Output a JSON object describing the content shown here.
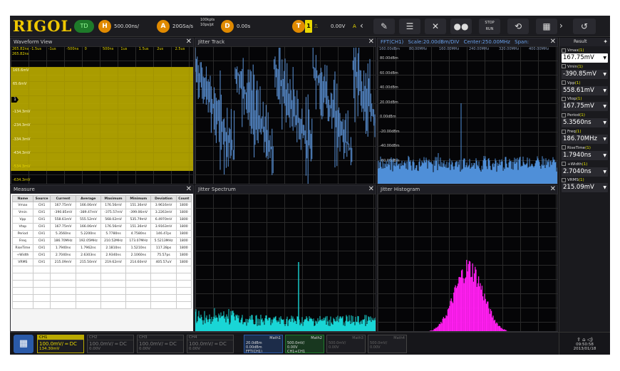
{
  "brand": "RIGOL",
  "topbar": {
    "mode": "TD",
    "h_badge": "H",
    "timebase": "500.00ns/",
    "a_badge": "A",
    "sample_rate": "20GSa/s",
    "memory_line1": "100kpts",
    "memory_line2": "10ps/pt",
    "d_badge": "D",
    "delay": "0.00s",
    "t_badge": "T",
    "trig_ch": "1",
    "trig_level": "0.00V",
    "a_badge2": "A",
    "run_stop_line1": "STOP",
    "run_stop_line2": "RUN",
    "icons": [
      "pen-icon",
      "menu-icon",
      "measure-icon",
      "dots-icon",
      "run-stop-icon",
      "history-icon",
      "apps-icon",
      "back-icon"
    ]
  },
  "waveform": {
    "title": "Waveform View",
    "time_row": [
      "265.82ns",
      "-1.5us",
      "-1us",
      "-500ns",
      "0",
      "500ns",
      "1us",
      "1.5us",
      "2us",
      "2.5us"
    ],
    "top_label": "265.82ns",
    "y_labels": [
      "165.6mV",
      "65.6mV",
      "",
      "-134.3mV",
      "-234.3mV",
      "-334.3mV",
      "-434.3mV",
      "-534.3mV",
      "-634.3mV"
    ],
    "ch_marker": "1"
  },
  "jitter_track": {
    "title": "Jitter Track"
  },
  "fft": {
    "title": "FFT(CH1)",
    "scale": "Scale:20.00dBm/DIV",
    "center": "Center:250.00MHz",
    "span": "Span:",
    "freq_row": [
      "160.00dBm",
      "80.00MHz",
      "160.00MHz",
      "240.00MHz",
      "320.00MHz",
      "400.00MHz"
    ],
    "db_labels": [
      "80.00dBm",
      "60.00dBm",
      "40.00dBm",
      "20.00dBm",
      "0.00dBm",
      "-20.00dBm",
      "-40.00dBm",
      "-60.00dBm"
    ]
  },
  "measure": {
    "title": "Measure",
    "headers": [
      "Name",
      "Source",
      "Current",
      "Average",
      "Maximum",
      "Minimum",
      "Deviation",
      "Count"
    ],
    "rows": [
      [
        "Vmax",
        "CH1",
        "167.75mV",
        "166.06mV",
        "176.56mV",
        "151.36mV",
        "3.9616mV",
        "1800"
      ],
      [
        "Vmin",
        "CH1",
        "-390.85mV",
        "-389.47mV",
        "-375.57mV",
        "-399.06mV",
        "3.2263mV",
        "1800"
      ],
      [
        "Vpp",
        "CH1",
        "558.61mV",
        "555.52mV",
        "568.02mV",
        "535.79mV",
        "6.4970mV",
        "1800"
      ],
      [
        "Vtop",
        "CH1",
        "167.75mV",
        "166.06mV",
        "176.56mV",
        "151.36mV",
        "3.9163mV",
        "1800"
      ],
      [
        "Period",
        "CH1",
        "5.3560ns",
        "5.2200ns",
        "5.7780ns",
        "4.7580ns",
        "146.47ps",
        "1800"
      ],
      [
        "Freq",
        "CH1",
        "186.70MHz",
        "192.05MHz",
        "210.52MHz",
        "173.07MHz",
        "5.5213MHz",
        "1800"
      ],
      [
        "RiseTime",
        "CH1",
        "1.7940ns",
        "1.7962ns",
        "2.1810ns",
        "1.5210ns",
        "117.28ps",
        "1800"
      ],
      [
        "+Width",
        "CH1",
        "2.7040ns",
        "2.6303ns",
        "2.9340ns",
        "2.1060ns",
        "75.57ps",
        "1800"
      ],
      [
        "VRMS",
        "CH1",
        "215.09mV",
        "215.50mV",
        "219.62mV",
        "214.60mV",
        "405.57uV",
        "1800"
      ]
    ]
  },
  "jitter_spectrum": {
    "title": "Jitter Spectrum"
  },
  "jitter_histogram": {
    "title": "Jitter Histogram"
  },
  "results": {
    "title": "Result",
    "items": [
      {
        "name": "Vmax",
        "n": "(1)",
        "value": "167.75mV"
      },
      {
        "name": "Vmin",
        "n": "(1)",
        "value": "-390.85mV"
      },
      {
        "name": "Vpp",
        "n": "(1)",
        "value": "558.61mV"
      },
      {
        "name": "Vtop",
        "n": "(1)",
        "value": "167.75mV"
      },
      {
        "name": "Period",
        "n": "(1)",
        "value": "5.3560ns"
      },
      {
        "name": "Freq",
        "n": "(1)",
        "value": "186.70MHz"
      },
      {
        "name": "RiseTime",
        "n": "(1)",
        "value": "1.7940ns"
      },
      {
        "name": "+Width",
        "n": "(1)",
        "value": "2.7040ns"
      },
      {
        "name": "VRMS",
        "n": "(1)",
        "value": "215.09mV"
      }
    ]
  },
  "bottom": {
    "channels": [
      {
        "name": "CH1",
        "scale": "100.0mV/",
        "coupling": "DC",
        "offset": "134.30mV"
      },
      {
        "name": "CH2",
        "scale": "100.0mV/",
        "coupling": "DC",
        "offset": "0.00V"
      },
      {
        "name": "CH3",
        "scale": "100.0mV/",
        "coupling": "DC",
        "offset": "0.00V"
      },
      {
        "name": "CH4",
        "scale": "100.0mV/",
        "coupling": "DC",
        "offset": "0.00V"
      }
    ],
    "maths": [
      {
        "name": "Math1",
        "l1": "20.0dBm",
        "l2": "0.00dBm",
        "l3": "FFT(CH1)"
      },
      {
        "name": "Math2",
        "l1": "500.0mV/",
        "l2": "0.00V",
        "l3": "CH1+CH1"
      },
      {
        "name": "Math3",
        "l1": "500.0mV/",
        "l2": "0.00V",
        "l3": ""
      },
      {
        "name": "Math4",
        "l1": "500.0mV/",
        "l2": "0.00V",
        "l3": ""
      }
    ],
    "time": "09:50:58",
    "date": "2013/01/18"
  }
}
